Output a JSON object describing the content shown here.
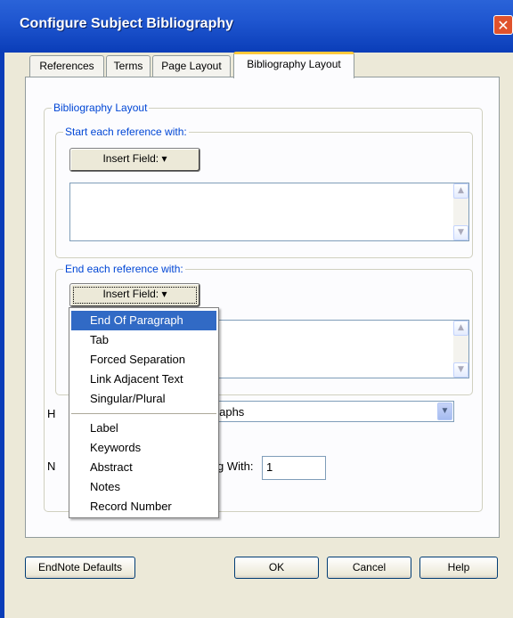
{
  "window": {
    "title": "Configure Subject Bibliography",
    "close_glyph": "✕"
  },
  "tabs": [
    {
      "label": "References"
    },
    {
      "label": "Terms"
    },
    {
      "label": "Page Layout"
    },
    {
      "label": "Bibliography Layout"
    }
  ],
  "bibliography_layout": {
    "group_label": "Bibliography Layout",
    "start": {
      "label": "Start each reference with:",
      "insert_field": "Insert Field:"
    },
    "end": {
      "label": "End each reference with:",
      "insert_field": "Insert Field:"
    },
    "heading_label_partial": "H",
    "select_value_partial": "ragraphs",
    "numbering_label_partial": "N",
    "numbering_label_end": "g With:",
    "numbering_value": "1"
  },
  "insert_field_menu": {
    "items_group1": [
      "End Of Paragraph",
      "Tab",
      "Forced Separation",
      "Link Adjacent Text",
      "Singular/Plural"
    ],
    "items_group2": [
      "Label",
      "Keywords",
      "Abstract",
      "Notes",
      "Record Number"
    ],
    "selected": "End Of Paragraph"
  },
  "buttons": {
    "defaults": "EndNote Defaults",
    "ok": "OK",
    "cancel": "Cancel",
    "help": "Help"
  },
  "icons": {
    "dropdown_arrow": "▾",
    "scroll_up": "▲",
    "scroll_down": "▼",
    "select_arrow": "▼"
  }
}
